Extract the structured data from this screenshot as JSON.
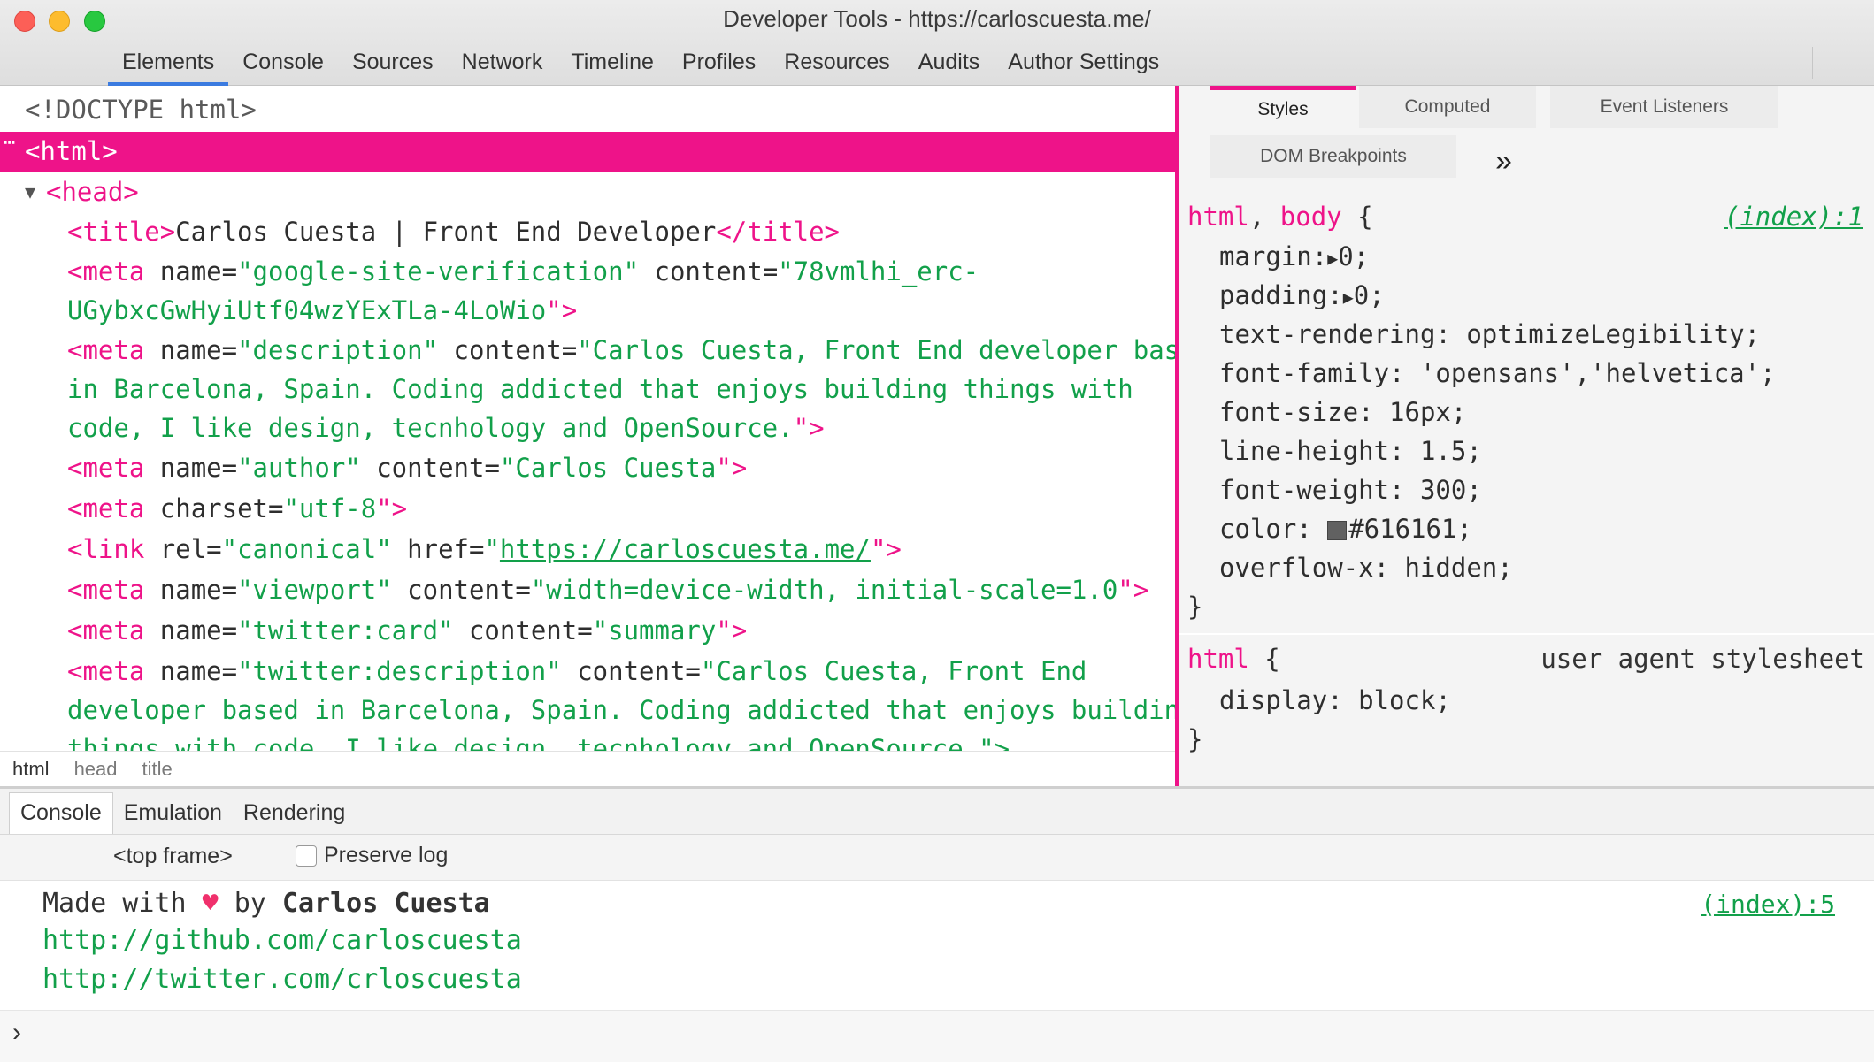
{
  "window": {
    "title": "Developer Tools - https://carloscuesta.me/"
  },
  "main_tabs": [
    {
      "label": "Elements",
      "active": true
    },
    {
      "label": "Console"
    },
    {
      "label": "Sources"
    },
    {
      "label": "Network"
    },
    {
      "label": "Timeline"
    },
    {
      "label": "Profiles"
    },
    {
      "label": "Resources"
    },
    {
      "label": "Audits"
    },
    {
      "label": "Author Settings"
    }
  ],
  "elements": {
    "doctype": "<!DOCTYPE html>",
    "html_ellipsis": "⋯",
    "html_tag": "<html>",
    "head_toggle": "▼",
    "head_tag": "<head>",
    "title_open": "<title>",
    "title_text": "Carlos Cuesta | Front End Developer",
    "title_close": "</title>",
    "meta_open": "<meta",
    "link_open": "<link",
    "tag_end": "\">",
    "m1_attr": " name=",
    "m1_name": "\"google-site-verification\"",
    "m1_attr2": " content=",
    "m1_val_a": "\"78vmlhi_erc-",
    "m1_val_b": "UGybxcGwHyiUtf04wzYExTLa-4LoWio",
    "m2_name": "\"description\"",
    "m2_val_a": "\"Carlos Cuesta, Front End developer based",
    "m2_val_b": "in Barcelona, Spain. Coding addicted that enjoys building things with",
    "m2_val_c": "code, I like design, tecnhology and OpenSource.",
    "m3_name": "\"author\"",
    "m3_val": "\"Carlos Cuesta",
    "m4_attr": " charset=",
    "m4_val": "\"utf-8",
    "l1_attr": " rel=",
    "l1_rel": "\"canonical\"",
    "l1_attr2": " href=",
    "l1_q": "\"",
    "l1_href": "https://carloscuesta.me/",
    "m5_name": "\"viewport\"",
    "m5_val": "\"width=device-width, initial-scale=1.0",
    "m6_name": "\"twitter:card\"",
    "m6_val": "\"summary",
    "m7_name": "\"twitter:description\"",
    "m7_val_a": "\"Carlos Cuesta, Front End",
    "m7_val_b": "developer based in Barcelona, Spain. Coding addicted that enjoys building",
    "m7_val_c": "things with code, I like design, tecnhology and OpenSource.\">"
  },
  "breadcrumbs": [
    "html",
    "head",
    "title"
  ],
  "styles_panel": {
    "tabs": [
      "Styles",
      "Computed",
      "Event Listeners",
      "DOM Breakpoints"
    ],
    "more": "»",
    "rule1": {
      "selector_a": "html",
      "comma": ",",
      "selector_b": " body",
      "brace_open": " {",
      "source": "(index):1",
      "decls": [
        {
          "prop": "margin:",
          "tri": "▶",
          "val": "0;"
        },
        {
          "prop": "padding:",
          "tri": "▶",
          "val": "0;"
        },
        {
          "text": "text-rendering: optimizeLegibility;"
        },
        {
          "text": "font-family: 'opensans','helvetica';"
        },
        {
          "text": "font-size: 16px;"
        },
        {
          "text": "line-height: 1.5;"
        },
        {
          "text": "font-weight: 300;"
        },
        {
          "prop": "color: ",
          "color_value": "#616161",
          "val": "#616161;"
        },
        {
          "text": "overflow-x: hidden;"
        }
      ],
      "brace_close": "}"
    },
    "rule2": {
      "selector": "html",
      "brace_open": " {",
      "source": "user agent stylesheet",
      "decl": "display: block;",
      "brace_close": "}"
    }
  },
  "drawer": {
    "tabs": [
      "Console",
      "Emulation",
      "Rendering"
    ],
    "frame": "<top frame>",
    "preserve_log": "Preserve log",
    "made_with": "Made with ",
    "heart": "♥",
    "by": " by ",
    "author": "Carlos Cuesta",
    "source": "(index):5",
    "links": [
      "http://github.com/carloscuesta",
      "http://twitter.com/crloscuesta"
    ],
    "prompt": "›"
  },
  "colors": {
    "accent": "#ee1389",
    "string": "#12a04a",
    "tab_underline": "#3b7be0"
  }
}
